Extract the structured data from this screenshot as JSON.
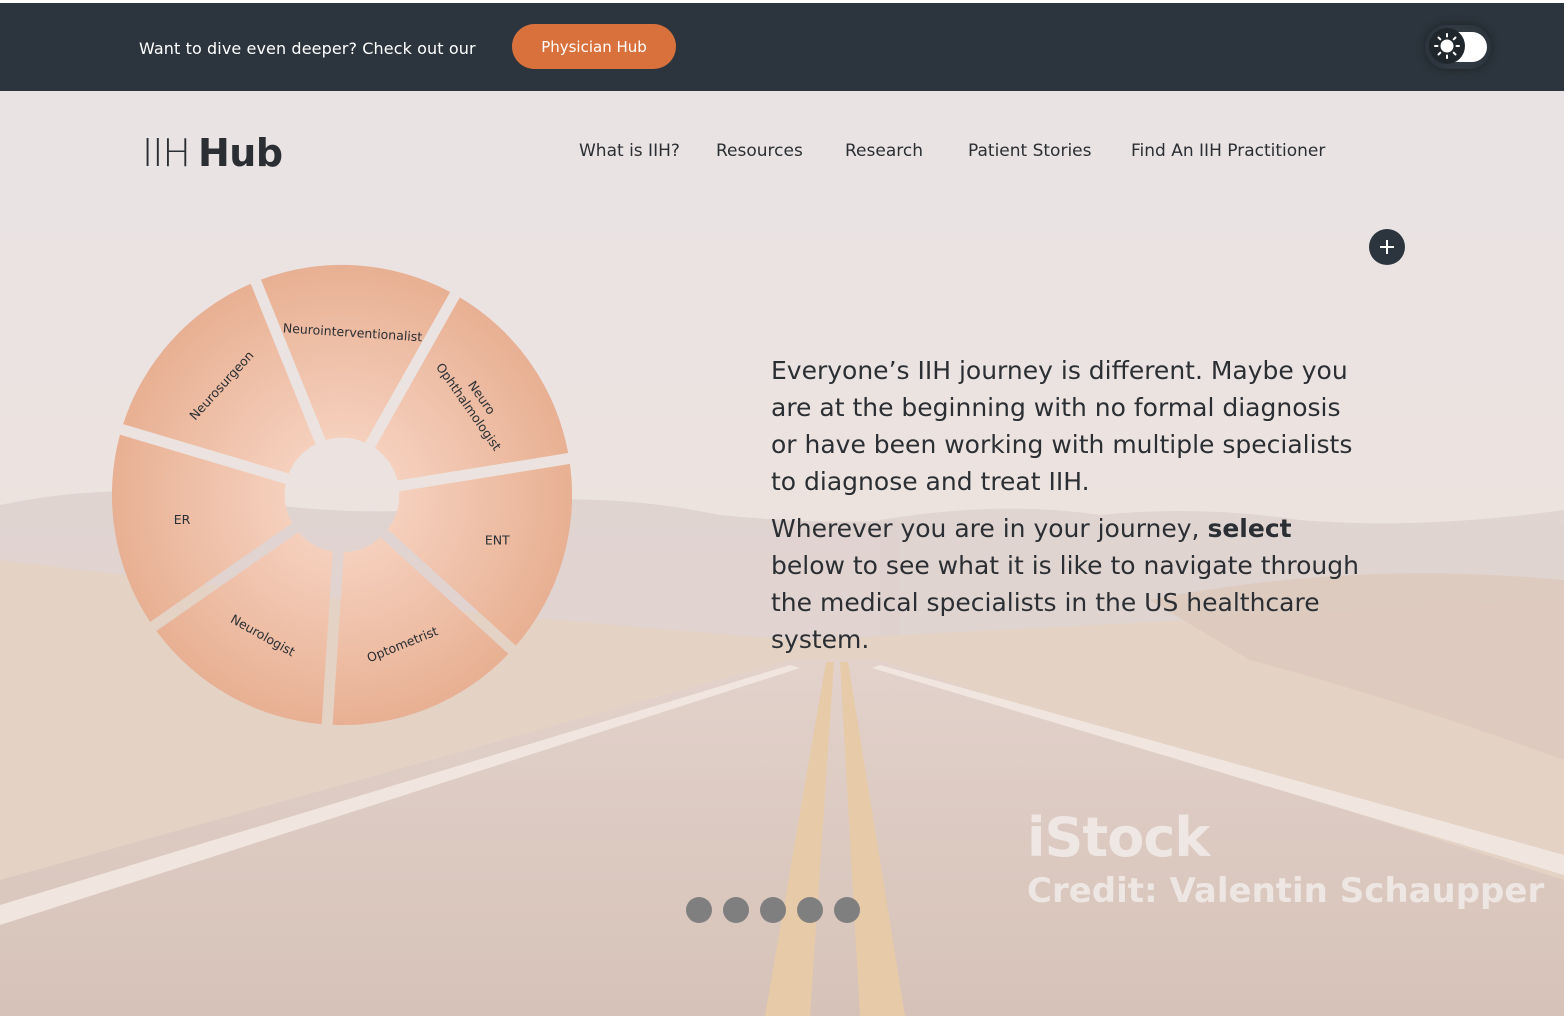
{
  "banner": {
    "text": "Want to dive even deeper? Check out our",
    "button_label": "Physician Hub"
  },
  "logo": {
    "light": "IIH",
    "bold": "Hub"
  },
  "nav": {
    "items": [
      {
        "label": "What is IIH?"
      },
      {
        "label": "Resources"
      },
      {
        "label": "Research"
      },
      {
        "label": "Patient Stories"
      },
      {
        "label": "Find An IIH Practitioner"
      }
    ]
  },
  "wheel": {
    "segments": [
      {
        "label": "Neurointerventionalist"
      },
      {
        "label": "Neuro",
        "label2": "Ophthalmologist"
      },
      {
        "label": "ENT"
      },
      {
        "label": "Optometrist"
      },
      {
        "label": "Neurologist"
      },
      {
        "label": "ER"
      },
      {
        "label": "Neurosurgeon"
      }
    ]
  },
  "intro": {
    "p1": "Everyone’s IIH journey is different. Maybe you are at the beginning with no formal diagnosis or have been working with multiple specialists to diagnose and treat IIH.",
    "p2_before": "Wherever you are in your journey, ",
    "p2_bold": "select",
    "p2_after": " below to see what it is like to navigate through the medical specialists in the US healthcare system."
  },
  "pagination": {
    "count": 5
  },
  "watermark": {
    "brand": "iStock",
    "credit": "Credit: Valentin Schaupper"
  },
  "colors": {
    "topbar": "#2c353d",
    "accent": "#d9713c",
    "wedge": "#e8b295",
    "text": "#2b2f33",
    "dot": "#7f7f7f"
  },
  "icons": {
    "toggle": "sun-icon",
    "add": "plus-icon"
  }
}
